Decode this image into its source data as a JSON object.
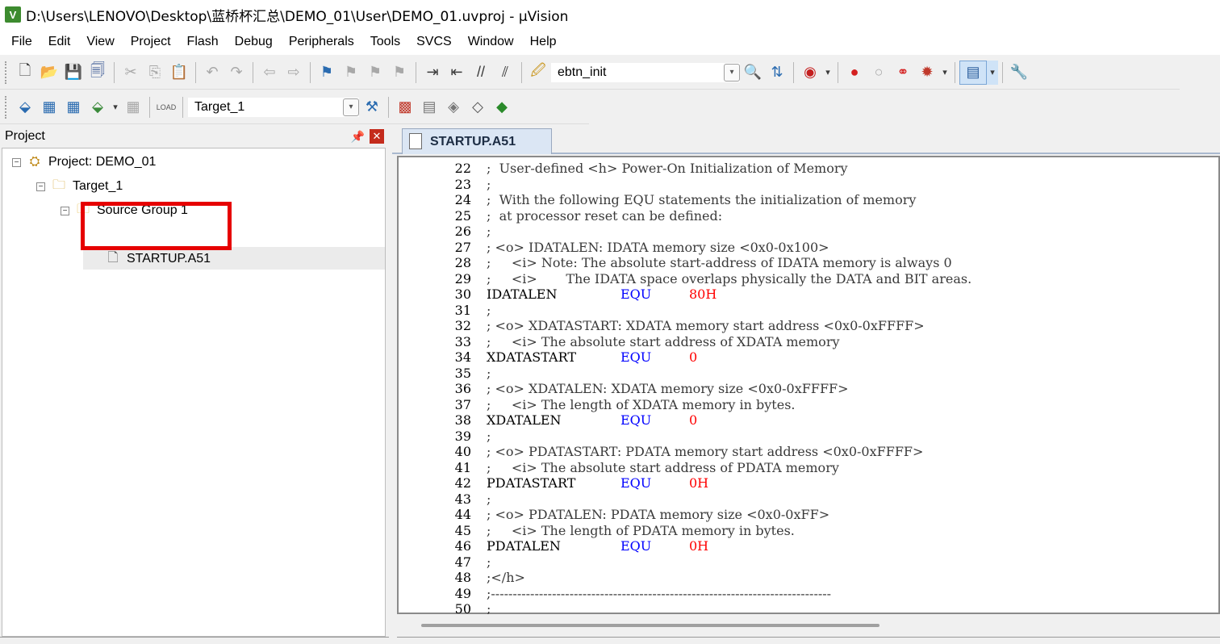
{
  "window": {
    "title": "D:\\Users\\LENOVO\\Desktop\\蓝桥杯汇总\\DEMO_01\\User\\DEMO_01.uvproj - µVision",
    "app_icon": "V"
  },
  "menu": [
    "File",
    "Edit",
    "View",
    "Project",
    "Flash",
    "Debug",
    "Peripherals",
    "Tools",
    "SVCS",
    "Window",
    "Help"
  ],
  "toolbar1": {
    "find_combo_value": "ebtn_init"
  },
  "toolbar2": {
    "target_combo_value": "Target_1"
  },
  "project_panel": {
    "title": "Project",
    "tree": {
      "project": "Project: DEMO_01",
      "target": "Target_1",
      "group": "Source Group 1",
      "file": "STARTUP.A51"
    }
  },
  "editor": {
    "active_tab": "STARTUP.A51",
    "lines": [
      {
        "n": "22",
        "c": ";  User-defined <h> Power-On Initialization of Memory"
      },
      {
        "n": "23",
        "c": ";"
      },
      {
        "n": "24",
        "c": ";  With the following EQU statements the initialization of memory"
      },
      {
        "n": "25",
        "c": ";  at processor reset can be defined:"
      },
      {
        "n": "26",
        "c": ";"
      },
      {
        "n": "27",
        "c": "; <o> IDATALEN: IDATA memory size <0x0-0x100>"
      },
      {
        "n": "28",
        "c": ";     <i> Note: The absolute start-address of IDATA memory is always 0"
      },
      {
        "n": "29",
        "c": ";     <i>       The IDATA space overlaps physically the DATA and BIT areas."
      },
      {
        "n": "30",
        "label": "IDATALEN",
        "op": "EQU",
        "val": "80H"
      },
      {
        "n": "31",
        "c": ";"
      },
      {
        "n": "32",
        "c": "; <o> XDATASTART: XDATA memory start address <0x0-0xFFFF>"
      },
      {
        "n": "33",
        "c": ";     <i> The absolute start address of XDATA memory"
      },
      {
        "n": "34",
        "label": "XDATASTART",
        "op": "EQU",
        "val": "0"
      },
      {
        "n": "35",
        "c": ";"
      },
      {
        "n": "36",
        "c": "; <o> XDATALEN: XDATA memory size <0x0-0xFFFF>"
      },
      {
        "n": "37",
        "c": ";     <i> The length of XDATA memory in bytes."
      },
      {
        "n": "38",
        "label": "XDATALEN",
        "op": "EQU",
        "val": "0"
      },
      {
        "n": "39",
        "c": ";"
      },
      {
        "n": "40",
        "c": "; <o> PDATASTART: PDATA memory start address <0x0-0xFFFF>"
      },
      {
        "n": "41",
        "c": ";     <i> The absolute start address of PDATA memory"
      },
      {
        "n": "42",
        "label": "PDATASTART",
        "op": "EQU",
        "val": "0H"
      },
      {
        "n": "43",
        "c": ";"
      },
      {
        "n": "44",
        "c": "; <o> PDATALEN: PDATA memory size <0x0-0xFF>"
      },
      {
        "n": "45",
        "c": ";     <i> The length of PDATA memory in bytes."
      },
      {
        "n": "46",
        "label": "PDATALEN",
        "op": "EQU",
        "val": "0H"
      },
      {
        "n": "47",
        "c": ";"
      },
      {
        "n": "48",
        "c": ";</h>"
      },
      {
        "n": "49",
        "c": ";------------------------------------------------------------------------------"
      },
      {
        "n": "50",
        "c": ";"
      }
    ]
  },
  "colors": {
    "keyword": "#0000ff",
    "number": "#ff0000",
    "highlight_box": "#e60000",
    "tab_bg": "#dbe6f4"
  }
}
